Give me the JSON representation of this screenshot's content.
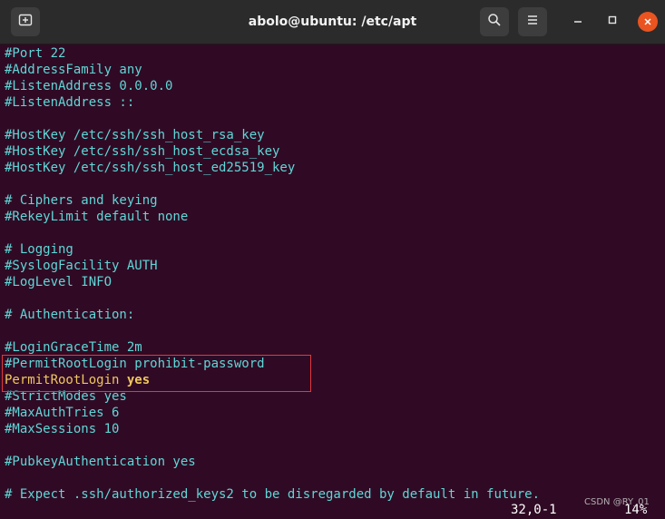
{
  "window": {
    "title": "abolo@ubuntu: /etc/apt"
  },
  "icons": {
    "new_tab": "new-tab-icon",
    "search": "search-icon",
    "menu": "hamburger-menu-icon",
    "minimize": "minimize-icon",
    "maximize": "maximize-icon",
    "close": "close-icon"
  },
  "colors": {
    "terminal_bg": "#300a24",
    "comment_text": "#5fd7d7",
    "active_text": "#f0c75e",
    "highlight_box": "#e0393e",
    "close_button": "#e95420"
  },
  "terminal": {
    "lines": [
      "#Port 22",
      "#AddressFamily any",
      "#ListenAddress 0.0.0.0",
      "#ListenAddress ::",
      "",
      "#HostKey /etc/ssh/ssh_host_rsa_key",
      "#HostKey /etc/ssh/ssh_host_ecdsa_key",
      "#HostKey /etc/ssh/ssh_host_ed25519_key",
      "",
      "# Ciphers and keying",
      "#RekeyLimit default none",
      "",
      "# Logging",
      "#SyslogFacility AUTH",
      "#LogLevel INFO",
      "",
      "# Authentication:",
      "",
      "#LoginGraceTime 2m",
      "#PermitRootLogin prohibit-password",
      "",
      "#StrictModes yes",
      "#MaxAuthTries 6",
      "#MaxSessions 10",
      "",
      "#PubkeyAuthentication yes",
      "",
      "# Expect .ssh/authorized_keys2 to be disregarded by default in future."
    ],
    "active_line_key": "PermitRootLogin",
    "active_line_value": "yes"
  },
  "status": {
    "cursor_position": "32,0-1",
    "scroll_percent": "14%"
  },
  "watermark": "CSDN @RY_01"
}
